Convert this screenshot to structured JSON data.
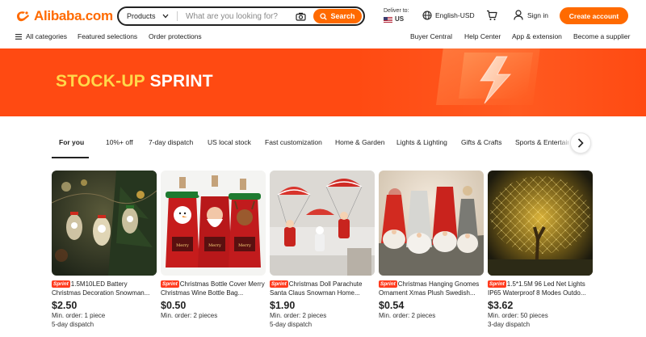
{
  "header": {
    "logo_text": "Alibaba.com",
    "search": {
      "category": "Products",
      "placeholder": "What are you looking for?",
      "button": "Search"
    },
    "deliver_to_label": "Deliver to:",
    "deliver_country": "US",
    "language": "English-USD",
    "sign_in": "Sign in",
    "create_account": "Create account"
  },
  "nav": {
    "all_categories": "All categories",
    "featured": "Featured selections",
    "protections": "Order protections",
    "buyer_central": "Buyer Central",
    "help_center": "Help Center",
    "app_extension": "App & extension",
    "become_supplier": "Become a supplier"
  },
  "banner": {
    "title_part1": "STOCK-UP",
    "title_part2": "SPRINT"
  },
  "tabs": [
    "For you",
    "10%+ off",
    "7-day dispatch",
    "US local stock",
    "Fast customization",
    "Home & Garden",
    "Lights & Lighting",
    "Gifts & Crafts",
    "Sports & Entertainment"
  ],
  "products": [
    {
      "badge": "Sprint",
      "name": "1.5M10LED Battery Christmas Decoration Snowman...",
      "price": "$2.50",
      "min_order": "Min. order: 1 piece",
      "dispatch": "5-day dispatch"
    },
    {
      "badge": "Sprint",
      "name": "Christmas Bottle Cover Merry Christmas Wine Bottle Bag...",
      "price": "$0.50",
      "min_order": "Min. order: 2 pieces",
      "dispatch": ""
    },
    {
      "badge": "Sprint",
      "name": "Christmas Doll Parachute Santa Claus Snowman Home...",
      "price": "$1.90",
      "min_order": "Min. order: 2 pieces",
      "dispatch": "5-day dispatch"
    },
    {
      "badge": "Sprint",
      "name": "Christmas Hanging Gnomes Ornament Xmas Plush Swedish...",
      "price": "$0.54",
      "min_order": "Min. order: 2 pieces",
      "dispatch": ""
    },
    {
      "badge": "Sprint",
      "name": "1.5*1.5M 96 Led Net Lights IP65 Waterproof 8 Modes Outdo...",
      "price": "$3.62",
      "min_order": "Min. order: 50 pieces",
      "dispatch": "3-day dispatch"
    }
  ],
  "colors": {
    "brand": "#ff6a00",
    "banner": "#ff4a12",
    "banner_title_accent": "#ffd84a",
    "badge": "#ff3b1e"
  }
}
